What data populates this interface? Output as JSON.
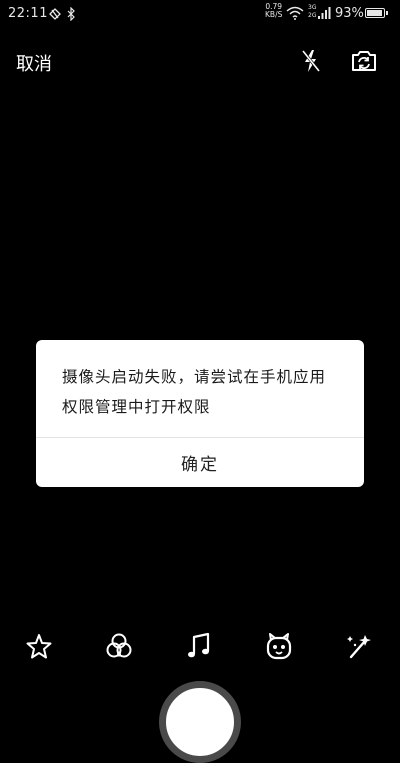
{
  "status_bar": {
    "time": "22:11",
    "net_speed_value": "0.79",
    "net_speed_unit": "KB/S",
    "sim1_label": "3G",
    "sim2_label": "2G",
    "battery": "93%",
    "battery_level": 0.93,
    "icons": [
      "sync-icon",
      "bluetooth-icon",
      "wifi-icon",
      "signal-icon",
      "signal-icon",
      "battery-icon"
    ]
  },
  "toolbar": {
    "cancel_label": "取消",
    "icons": [
      "flash-off-icon",
      "switch-camera-icon"
    ]
  },
  "dialog": {
    "message": "摄像头启动失败，请尝试在手机应用权限管理中打开权限",
    "ok_label": "确定"
  },
  "mode_bar": {
    "icons": [
      "star-icon",
      "filter-icon",
      "music-note-icon",
      "sticker-character-icon",
      "magic-wand-icon"
    ]
  },
  "colors": {
    "background": "#000000",
    "dialog": "#ffffff",
    "shutter_ring": "#4a4a4a"
  }
}
